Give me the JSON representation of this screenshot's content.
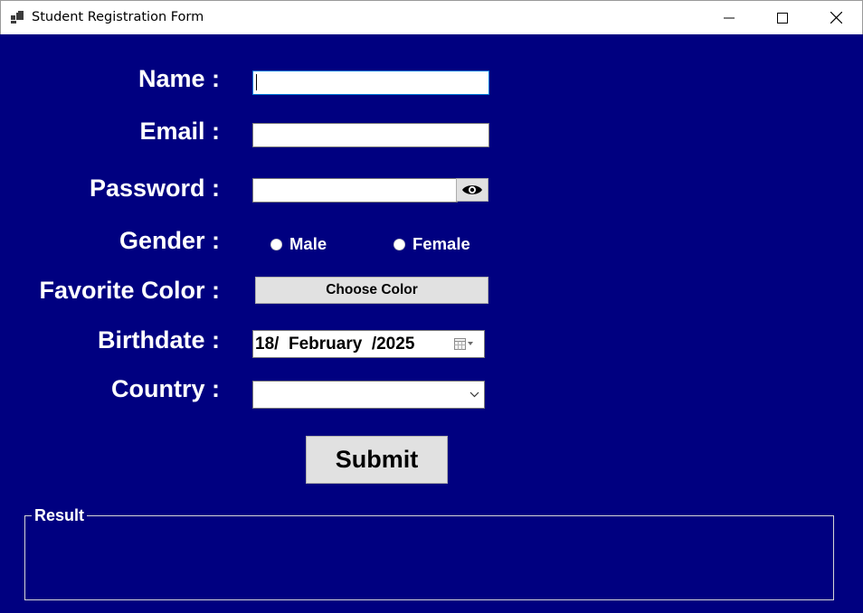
{
  "window": {
    "title": "Student Registration Form"
  },
  "form": {
    "name_label": "Name :",
    "name_value": "",
    "email_label": "Email :",
    "email_value": "",
    "password_label": "Password :",
    "password_value": "",
    "gender_label": "Gender :",
    "gender_options": [
      "Male",
      "Female"
    ],
    "favorite_color_label": "Favorite Color :",
    "choose_color_button": "Choose Color",
    "birthdate_label": "Birthdate :",
    "birthdate_value": "18/  February  /2025",
    "country_label": "Country :",
    "country_value": "",
    "submit_button": "Submit"
  },
  "result": {
    "label": "Result",
    "content": ""
  },
  "colors": {
    "background": "#000080",
    "label_text": "#ffffff",
    "button_face": "#e1e1e1",
    "focus_border": "#0078d7"
  }
}
